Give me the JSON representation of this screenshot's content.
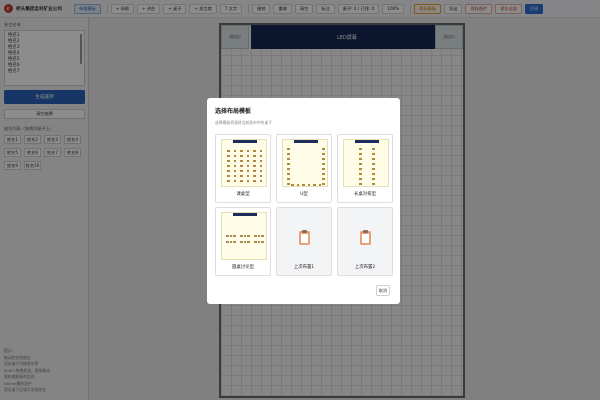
{
  "app": {
    "logo_text": "矿",
    "company": "桥头集团孟村矿业公司"
  },
  "toolbar": {
    "layout_template": "布局模板",
    "btn_grid": "+ 网格",
    "btn_podium": "+ 讲台",
    "btn_table": "+ 桌子",
    "btn_desk_table": "+ 发言席",
    "btn_text": "T 文字",
    "btn_undo": "撤销",
    "btn_redo": "重做",
    "btn_clear": "清空",
    "btn_mark": "标注",
    "seat_info": "桌子: 0 / 已排: 0",
    "zoom": "100%",
    "btn_save_template": "保存模板",
    "btn_export": "导出",
    "btn_save_image": "保存图片",
    "btn_save_all": "保存全部",
    "btn_print": "打印"
  },
  "sidebar": {
    "names_title": "参会名单",
    "names": [
      "姓名1",
      "姓名2",
      "姓名3",
      "姓名4",
      "姓名5",
      "姓名6",
      "姓名7"
    ],
    "generate": "生成座牌",
    "clear": "清空座牌",
    "grid_title": "座位列表（拖拽到桌子上）",
    "chips": [
      "姓名1",
      "姓名2",
      "姓名3",
      "姓名4",
      "姓名5",
      "姓名6",
      "姓名7",
      "姓名8",
      "姓名9",
      "姓名10"
    ],
    "tips": [
      "提示:",
      "拖动姓名到座位",
      "双击桌子可修改名称",
      "Shift+拖拽多选，整体移动",
      "滚轮缩放画布比例",
      "Delete删除选中",
      "双击桌子区域可添加姓名"
    ]
  },
  "canvas": {
    "led": "LED屏幕",
    "door_left": "进出口",
    "door_right": "进出口"
  },
  "modal": {
    "title": "选择布局模板",
    "subtitle": "选择模板将清除当前画布中的桌子",
    "cards": [
      {
        "label": "课桌型"
      },
      {
        "label": "U型"
      },
      {
        "label": "长桌对排型"
      },
      {
        "label": "圆桌讨论型"
      },
      {
        "label": "上次布置1"
      },
      {
        "label": "上次布置2"
      }
    ],
    "cancel": "取消"
  },
  "colors": {
    "primary": "#2a63b8",
    "led": "#162a57",
    "brand_red": "#c0392b"
  }
}
